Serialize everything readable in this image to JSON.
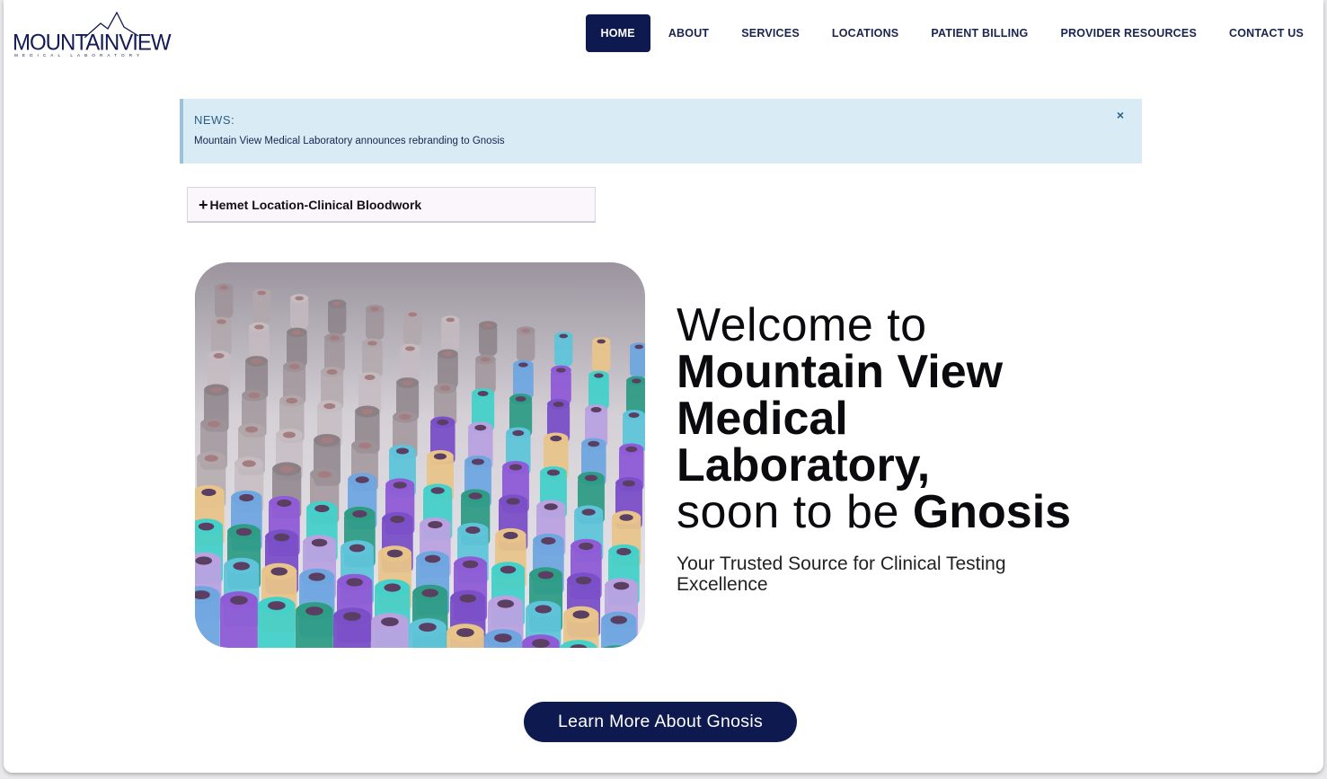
{
  "brand": {
    "logo_text": "MOUNTAINVIEW",
    "logo_subtitle": "MEDICAL LABORATORY"
  },
  "nav": {
    "items": [
      {
        "label": "HOME",
        "active": true
      },
      {
        "label": "ABOUT"
      },
      {
        "label": "SERVICES"
      },
      {
        "label": "LOCATIONS"
      },
      {
        "label": "PATIENT BILLING"
      },
      {
        "label": "PROVIDER RESOURCES"
      },
      {
        "label": "CONTACT US"
      }
    ]
  },
  "news": {
    "label": "NEWS:",
    "text": "Mountain View Medical Laboratory announces rebranding to Gnosis",
    "close": "×"
  },
  "accordion": {
    "icon": "plus-icon",
    "label": "Hemet Location-Clinical Bloodwork"
  },
  "hero": {
    "line1": "Welcome to",
    "line2": "Mountain View",
    "line3": "Medical",
    "line4": "Laboratory,",
    "line5_light": "soon to be ",
    "line5_bold": "Gnosis",
    "subtitle": "Your Trusted Source for Clinical Testing Excellence",
    "image_alt": "test-tubes-photo"
  },
  "cta": {
    "label": "Learn More About Gnosis"
  },
  "colors": {
    "brand_navy": "#0e1a4f",
    "news_bg": "#d9ecf5",
    "news_label": "#2b5f86"
  }
}
